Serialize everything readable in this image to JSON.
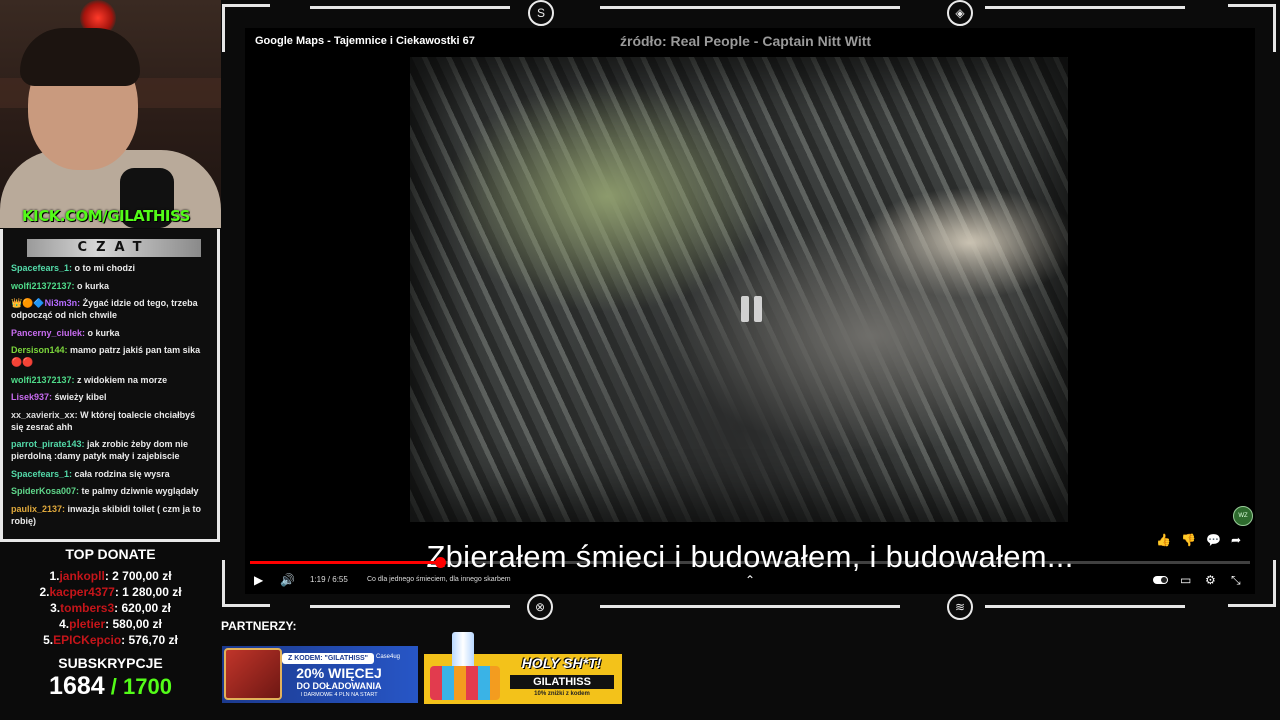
{
  "stream": {
    "kick_handle": "KICK.COM/GILATHISS"
  },
  "chat": {
    "header": "CZAT",
    "messages": [
      {
        "user": "Spacefears_1:",
        "text": " o to mi chodzi",
        "color": "#53d9a8"
      },
      {
        "user": "wolfi21372137:",
        "text": " o kurka",
        "color": "#4fdc8a"
      },
      {
        "user": "👑🟠🔷Ni3m3n:",
        "text": " Żygać idzie od tego, trzeba odpocząć od nich chwile",
        "color": "#b56bff"
      },
      {
        "user": "Pancerny_ciulek:",
        "text": " o kurka",
        "color": "#c86cf0"
      },
      {
        "user": "Dersison144:",
        "text": " mamo patrz jakiś pan tam sika 🔴🔴",
        "color": "#7cd63c"
      },
      {
        "user": "wolfi21372137:",
        "text": " z widokiem na morze",
        "color": "#4fdc8a"
      },
      {
        "user": "Lisek937:",
        "text": " świeży kibel",
        "color": "#c86cf0"
      },
      {
        "user": "xx_xavierix_xx:",
        "text": " W której toalecie chciałbyś się zesrać ahh",
        "color": "#dcdcdc"
      },
      {
        "user": "parrot_pirate143:",
        "text": " jak zrobic żeby dom nie pierdolną :damy patyk mały i zajebiscie",
        "color": "#53d9a8"
      },
      {
        "user": "Spacefears_1:",
        "text": " cała rodzina się wysra",
        "color": "#53d9a8"
      },
      {
        "user": "SpiderKosa007:",
        "text": " te palmy dziwnie wyglądały",
        "color": "#5fd68a"
      },
      {
        "user": "paulix_2137:",
        "text": " inwazja skibidi toilet ( czm ja to robię)",
        "color": "#e0a93c"
      }
    ]
  },
  "donations": {
    "title": "TOP DONATE",
    "items": [
      {
        "rank": "1.",
        "name": "jankopll",
        "amount": ": 2 700,00 zł"
      },
      {
        "rank": "2.",
        "name": "kacper4377",
        "amount": ": 1 280,00 zł"
      },
      {
        "rank": "3.",
        "name": "tombers3",
        "amount": ": 620,00 zł"
      },
      {
        "rank": "4.",
        "name": "pletier",
        "amount": ": 580,00 zł"
      },
      {
        "rank": "5.",
        "name": "EPICKepcio",
        "amount": ": 576,70 zł"
      }
    ]
  },
  "subscriptions": {
    "label": "SUBSKRYPCJE",
    "current": "1684",
    "goal": " / 1700"
  },
  "video": {
    "title": "Google Maps - Tajemnice i Ciekawostki 67",
    "source": "źródło: Real People - Captain Nitt Witt",
    "subtitle": "Zbierałem śmieci i budowałem, i budowałem...",
    "current_time": "1:19 / 6:55",
    "chapter": "Co dla jednego śmieciem, dla innego skarbem",
    "progress_fraction": 0.19,
    "channel_badge": "WZ"
  },
  "partners": {
    "title": "PARTNERZY:",
    "ad1": {
      "code": "Z KODEM: \"GILATHISS\"",
      "brand": "Case4ug",
      "headline": "20% WIĘCEJ",
      "line2": "DO DOŁADOWANIA",
      "line3": "I DARMOWE 4 PLN NA START"
    },
    "ad2": {
      "headline": "HOLY SH*T!",
      "code": "GILATHISS",
      "line2": "10% zniżki z kodem"
    }
  }
}
